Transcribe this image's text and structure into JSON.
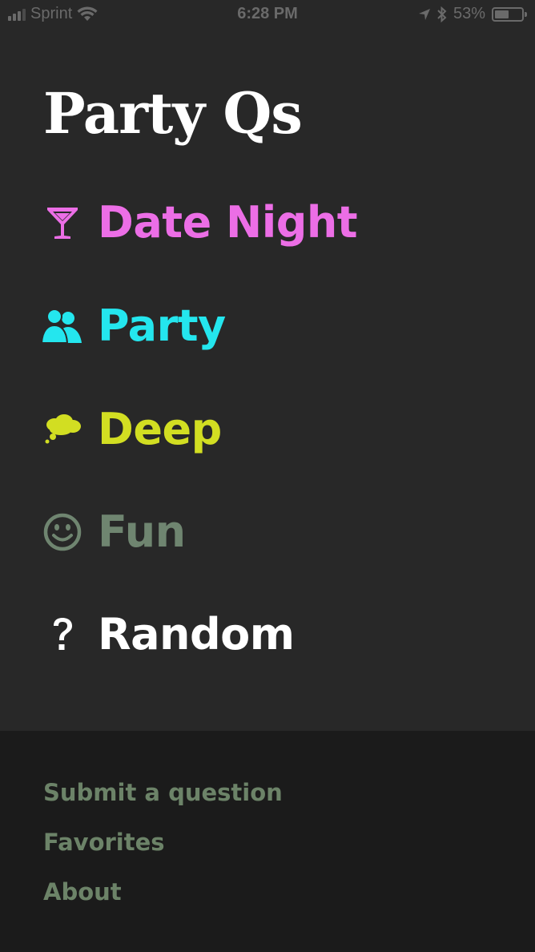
{
  "status_bar": {
    "carrier": "Sprint",
    "time": "6:28 PM",
    "battery_percent": "53%",
    "battery_level": 0.53,
    "icons": [
      "signal-icon",
      "wifi-icon",
      "location-arrow-icon",
      "bluetooth-icon",
      "battery-icon"
    ]
  },
  "app": {
    "title": "Party Qs"
  },
  "menu": {
    "items": [
      {
        "id": "date-night",
        "label": "Date Night",
        "icon": "cocktail-icon",
        "color": "#ec6ee6"
      },
      {
        "id": "party",
        "label": "Party",
        "icon": "users-icon",
        "color": "#24e6ee"
      },
      {
        "id": "deep",
        "label": "Deep",
        "icon": "thought-bubble-icon",
        "color": "#d2de22"
      },
      {
        "id": "fun",
        "label": "Fun",
        "icon": "smiley-icon",
        "color": "#6f8570"
      },
      {
        "id": "random",
        "label": "Random",
        "icon": "question-mark-icon",
        "color": "#ffffff"
      }
    ]
  },
  "footer": {
    "links": [
      {
        "label": "Submit a question"
      },
      {
        "label": "Favorites"
      },
      {
        "label": "About"
      }
    ],
    "link_color": "#6c8368"
  },
  "colors": {
    "background": "#282828",
    "footer_background": "#1b1b1b",
    "title": "#ffffff"
  }
}
